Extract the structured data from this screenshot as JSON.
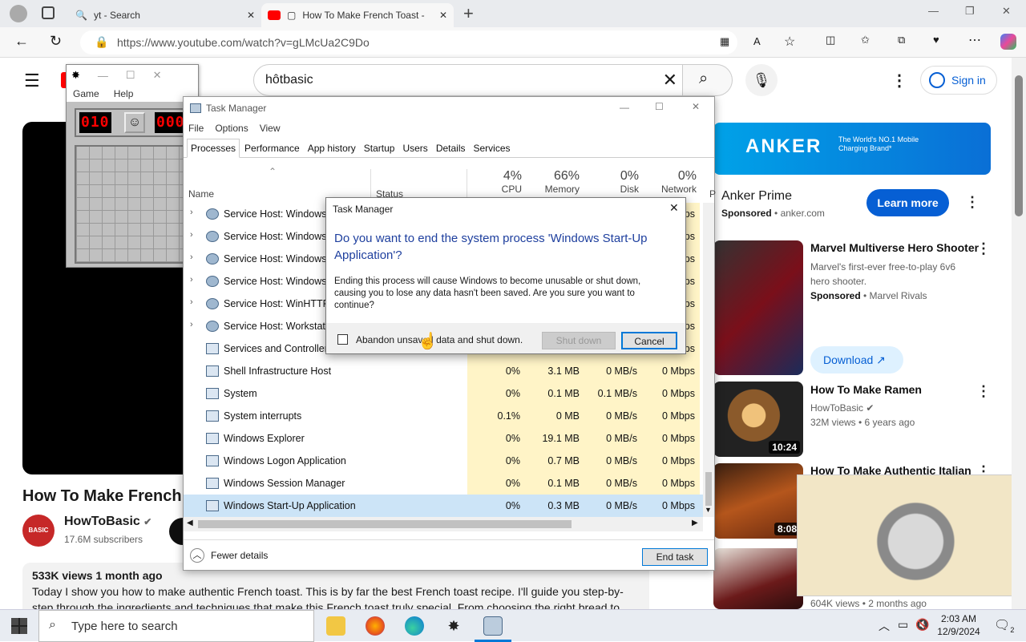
{
  "browser": {
    "tabs": [
      {
        "label": "yt - Search"
      },
      {
        "label": "How To Make French Toast -"
      }
    ],
    "url": "https://www.youtube.com/watch?v=gLMcUa2C9Do"
  },
  "youtube": {
    "search_value": "hôtbasic",
    "sign_in": "Sign in",
    "video_title": "How To Make French T",
    "channel": "HowToBasic",
    "channel_avatar_text": "BASIC",
    "subscribers": "17.6M subscribers",
    "views_date": "533K views  1 month ago",
    "description": "Today I show you how to make authentic French toast. This is by far the best French toast recipe. I'll guide you step-by-step through the ingredients and techniques that make this French toast truly special. From choosing the right bread to",
    "ad": {
      "banner_brand": "ANKER",
      "banner_tagline": "The World's NO.1 Mobile Charging Brand*",
      "title": "Anker Prime",
      "sponsored": "Sponsored",
      "domain": "anker.com",
      "cta": "Learn more"
    },
    "side": [
      {
        "title": "Marvel Multiverse Hero Shooter",
        "meta1": "Marvel's first-ever free-to-play 6v6",
        "meta2": "hero shooter.",
        "sponsored": "Sponsored",
        "channel": "Marvel Rivals",
        "cta": "Download"
      },
      {
        "title": "How To Make Ramen",
        "channel": "HowToBasic",
        "meta": "32M views  •  6 years ago",
        "duration": "10:24"
      },
      {
        "title": "How To Make Authentic Italian",
        "duration": "8:08"
      },
      {
        "meta": "604K views  •  2 months ago"
      }
    ]
  },
  "minesweeper": {
    "menu": [
      "Game",
      "Help"
    ],
    "mines_left": "010",
    "timer": "000"
  },
  "task_manager": {
    "title": "Task Manager",
    "menu": [
      "File",
      "Options",
      "View"
    ],
    "tabs": [
      "Processes",
      "Performance",
      "App history",
      "Startup",
      "Users",
      "Details",
      "Services"
    ],
    "columns": {
      "name": "Name",
      "status": "Status",
      "cpu_pct": "4%",
      "cpu": "CPU",
      "mem_pct": "66%",
      "mem": "Memory",
      "disk_pct": "0%",
      "disk": "Disk",
      "net_pct": "0%",
      "net": "Network",
      "power_abbr": "P"
    },
    "partial_unit": "ps",
    "rows": [
      {
        "name": "Service Host: Windows M",
        "expand": true
      },
      {
        "name": "Service Host: Windows P",
        "expand": true
      },
      {
        "name": "Service Host: Windows P",
        "expand": true
      },
      {
        "name": "Service Host: Windows T",
        "expand": true
      },
      {
        "name": "Service Host: WinHTTP W",
        "expand": true
      },
      {
        "name": "Service Host: Workstatio",
        "expand": true
      },
      {
        "name": "Services and Controller a",
        "expand": false
      },
      {
        "name": "Shell Infrastructure Host",
        "cpu": "0%",
        "mem": "3.1 MB",
        "disk": "0 MB/s",
        "net": "0 Mbps"
      },
      {
        "name": "System",
        "cpu": "0%",
        "mem": "0.1 MB",
        "disk": "0.1 MB/s",
        "net": "0 Mbps"
      },
      {
        "name": "System interrupts",
        "cpu": "0.1%",
        "mem": "0 MB",
        "disk": "0 MB/s",
        "net": "0 Mbps"
      },
      {
        "name": "Windows Explorer",
        "cpu": "0%",
        "mem": "19.1 MB",
        "disk": "0 MB/s",
        "net": "0 Mbps"
      },
      {
        "name": "Windows Logon Application",
        "cpu": "0%",
        "mem": "0.7 MB",
        "disk": "0 MB/s",
        "net": "0 Mbps"
      },
      {
        "name": "Windows Session Manager",
        "cpu": "0%",
        "mem": "0.1 MB",
        "disk": "0 MB/s",
        "net": "0 Mbps"
      },
      {
        "name": "Windows Start-Up Application",
        "cpu": "0%",
        "mem": "0.3 MB",
        "disk": "0 MB/s",
        "net": "0 Mbps",
        "selected": true
      }
    ],
    "fewer_details": "Fewer details",
    "end_task": "End task"
  },
  "dialog": {
    "title": "Task Manager",
    "heading": "Do you want to end the system process 'Windows Start-Up Application'?",
    "body": "Ending this process will cause Windows to become unusable or shut down, causing you to lose any data hasn't been saved. Are you sure you want to continue?",
    "checkbox_label": "Abandon unsaved data and shut down.",
    "shutdown": "Shut down",
    "cancel": "Cancel"
  },
  "taskbar": {
    "search_placeholder": "Type here to search",
    "time": "2:03 AM",
    "date": "12/9/2024",
    "notification_count": "2"
  },
  "colors": {
    "accent": "#0067c0",
    "youtube_red": "#ff0000",
    "cpu_fill": "#fff4c7"
  }
}
